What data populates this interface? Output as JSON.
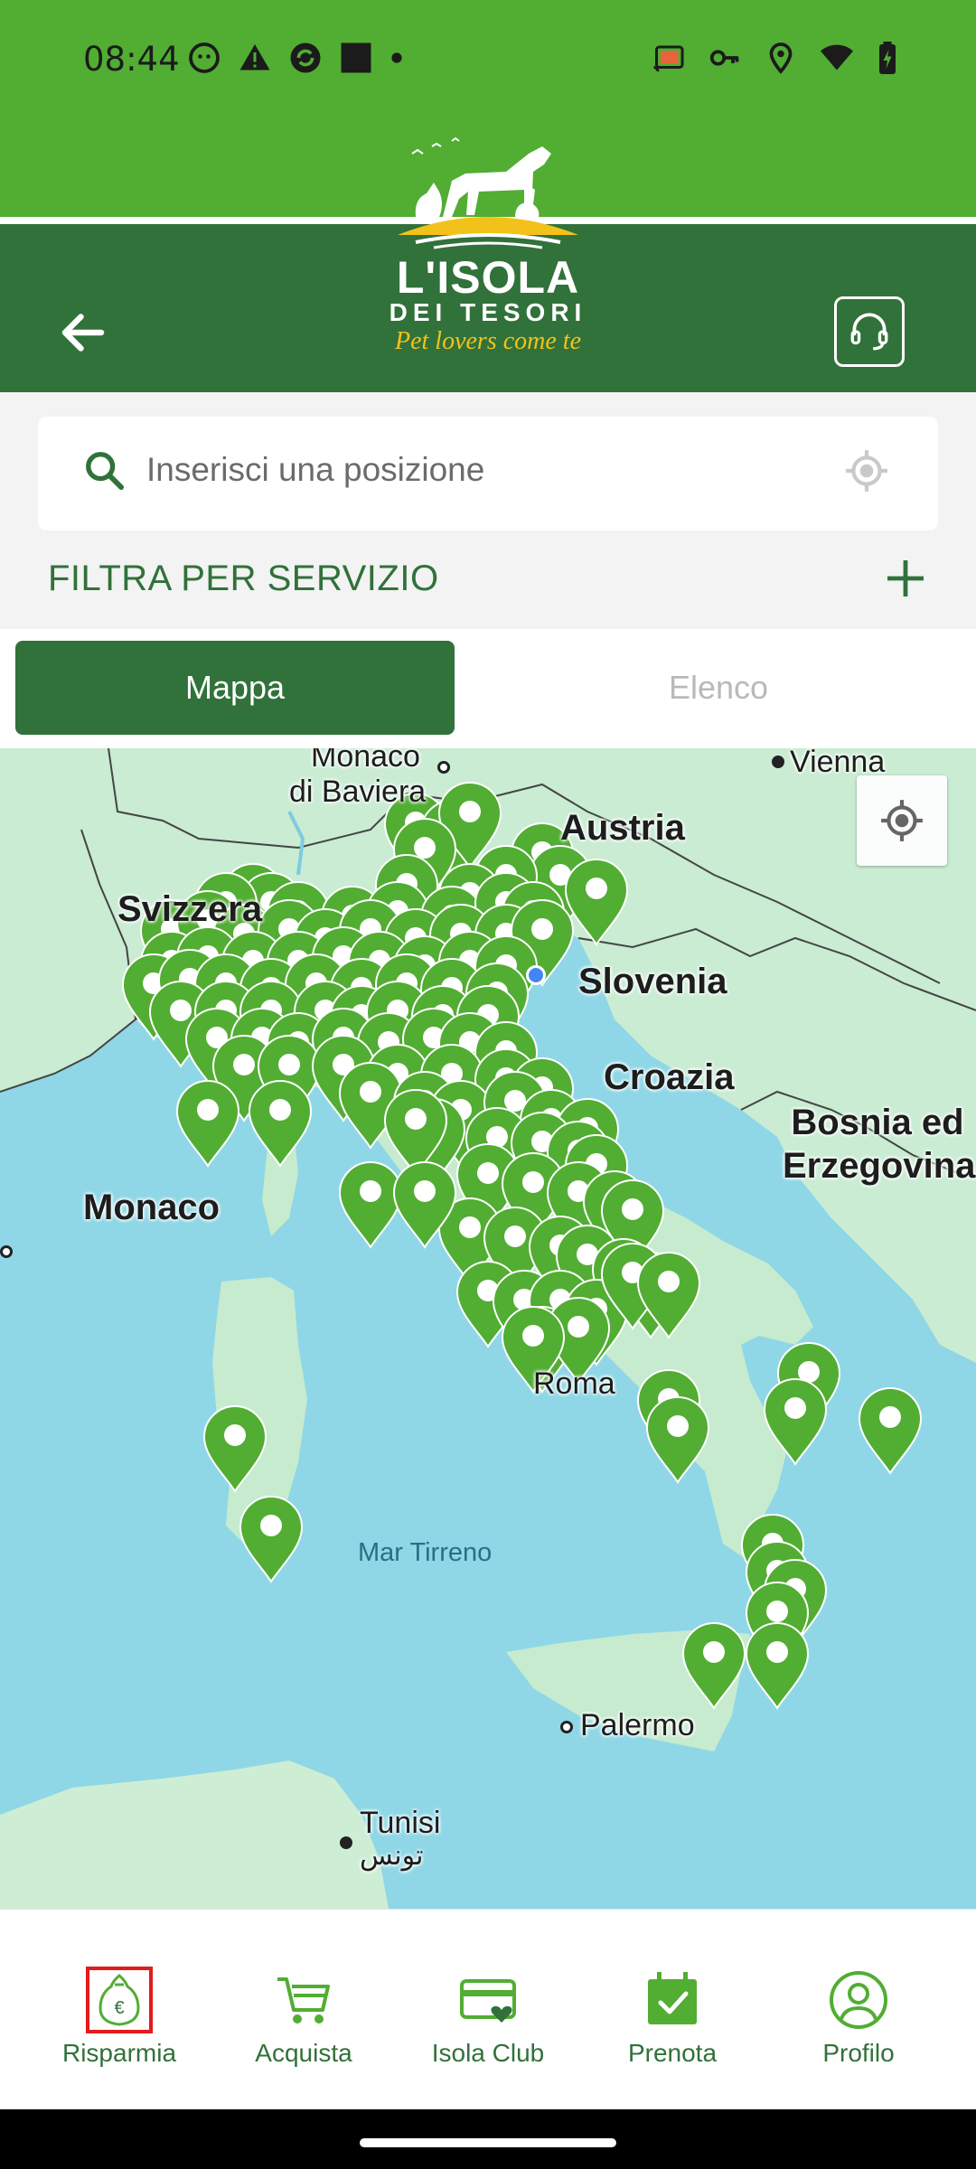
{
  "status_bar": {
    "time": "08:44",
    "left_icons": [
      "face-icon",
      "warning-icon",
      "sync-icon",
      "square-icon",
      "dot-icon"
    ],
    "right_icons": [
      "cast-icon",
      "key-icon",
      "location-icon",
      "wifi-icon",
      "battery-icon"
    ]
  },
  "header": {
    "brand_line1": "L'ISOLA",
    "brand_line2": "DEI TESORI",
    "tagline": "Pet lovers come te",
    "back_icon": "arrow-left-icon",
    "support_icon": "headset-icon",
    "colors": {
      "primary": "#52ad33",
      "dark": "#31713a",
      "accent": "#f3c21a"
    }
  },
  "search": {
    "placeholder": "Inserisci una posizione",
    "value": ""
  },
  "filter": {
    "label": "FILTRA PER SERVIZIO",
    "expand_icon": "plus-icon"
  },
  "tabs": [
    {
      "label": "Mappa",
      "selected": true
    },
    {
      "label": "Elenco",
      "selected": false
    }
  ],
  "map": {
    "labels": {
      "monaco_baviera": "Monaco di Baviera",
      "vienna": "Vienna",
      "austria": "Austria",
      "svizzera": "Svizzera",
      "slovenia": "Slovenia",
      "croazia": "Croazia",
      "bosnia": "Bosnia ed Erzegovina",
      "monaco": "Monaco",
      "roma": "Roma",
      "mar_tirreno": "Mar Tirreno",
      "palermo": "Palermo",
      "tunisi": "Tunisi",
      "tunisi_ar": "تونس"
    },
    "pin_color": "#52ad33"
  },
  "bottom_nav": [
    {
      "label": "Risparmia",
      "icon": "piggy-bank-euro-icon",
      "active": true
    },
    {
      "label": "Acquista",
      "icon": "cart-icon",
      "active": false
    },
    {
      "label": "Isola Club",
      "icon": "card-heart-icon",
      "active": false
    },
    {
      "label": "Prenota",
      "icon": "calendar-check-icon",
      "active": false
    },
    {
      "label": "Profilo",
      "icon": "user-circle-icon",
      "active": false
    }
  ]
}
